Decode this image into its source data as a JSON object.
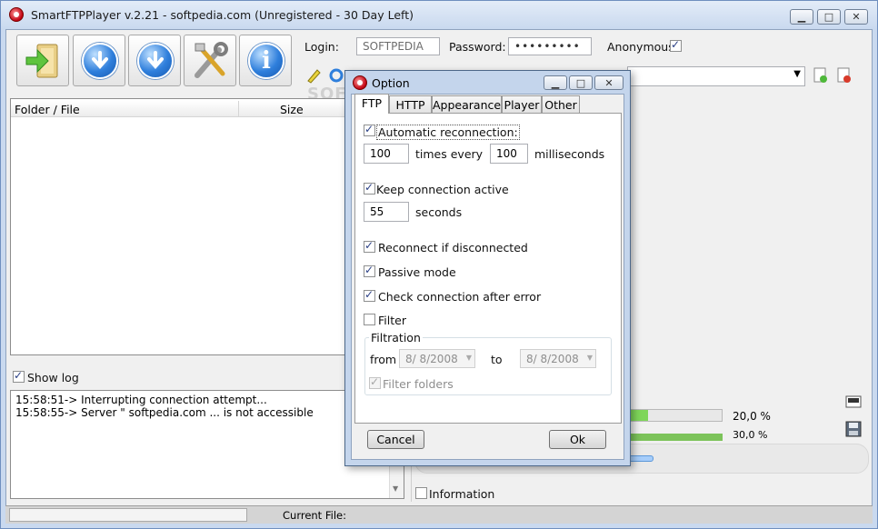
{
  "window": {
    "title": "SmartFTPPlayer v.2.21 - softpedia.com (Unregistered - 30 Day Left)",
    "minimize_label": "▁",
    "maximize_label": "□",
    "close_label": "✕"
  },
  "toolbar": {
    "login_label": "Login:",
    "login_value": "SOFTPEDIA",
    "password_label": "Password:",
    "password_value": "•••••••••",
    "anonymous_label": "Anonymous",
    "info_glyph": "i"
  },
  "filelist": {
    "col_folder": "Folder / File",
    "col_size": "Size"
  },
  "log": {
    "show_log_label": "Show log",
    "lines": [
      "15:58:51-> Interrupting connection attempt...",
      "15:58:55-> Server \" softpedia.com ... is not accessible"
    ]
  },
  "right": {
    "progress1_text": "20,0 %",
    "progress2_text": "30,0 %",
    "information_label": "Information"
  },
  "status": {
    "current_file_label": "Current File:"
  },
  "watermark": "SOFTPEDIA",
  "dialog": {
    "title": "Option",
    "tabs": [
      "FTP",
      "HTTP",
      "Appearance",
      "Player",
      "Other"
    ],
    "auto_reconnect_label": "Automatic reconnection:",
    "times_value": "100",
    "times_every_label": "times every",
    "ms_value": "100",
    "milliseconds_label": "milliseconds",
    "keep_active_label": "Keep connection active",
    "seconds_value": "55",
    "seconds_label": "seconds",
    "reconnect_label": "Reconnect if disconnected",
    "passive_label": "Passive mode",
    "check_conn_label": "Check connection after error",
    "filter_label": "Filter",
    "filtration_label": "Filtration",
    "from_label": "from",
    "from_date": "8/  8/2008",
    "to_label": "to",
    "to_date": "8/  8/2008",
    "filter_folders_label": "Filter folders",
    "cancel_label": "Cancel",
    "ok_label": "Ok"
  }
}
